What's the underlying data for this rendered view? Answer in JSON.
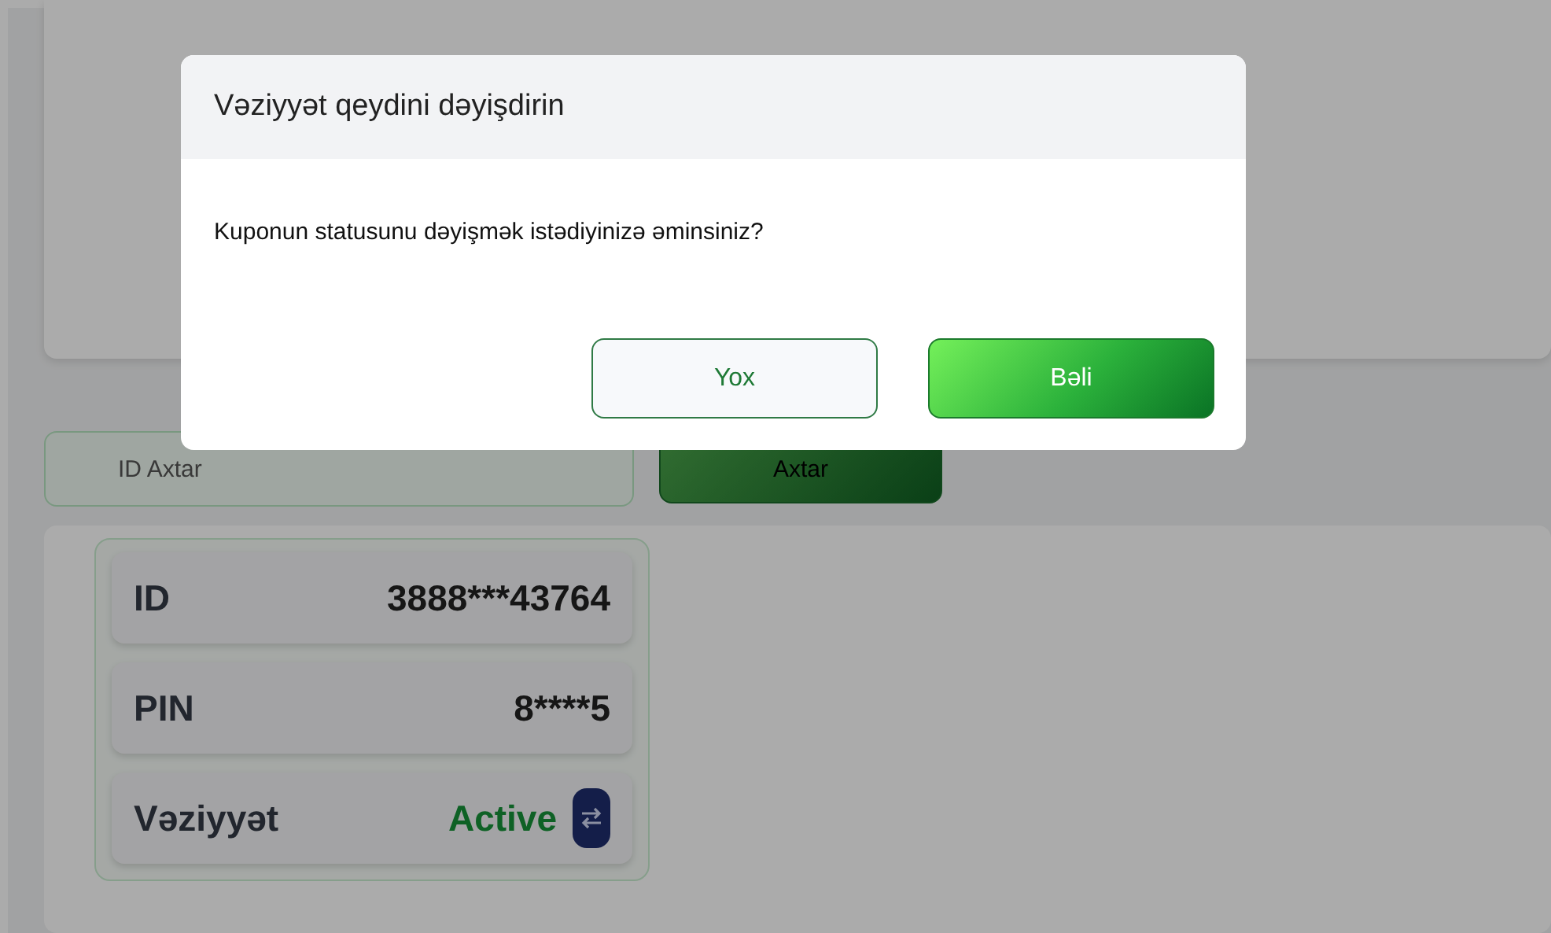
{
  "search": {
    "placeholder": "ID Axtar",
    "button": "Axtar"
  },
  "coupon": {
    "rows": [
      {
        "kind": "plain",
        "label": "ID",
        "value": "3888***43764"
      },
      {
        "kind": "plain",
        "label": "PIN",
        "value": "8****5"
      },
      {
        "kind": "status",
        "label": "Vəziyyət",
        "value": "Active"
      }
    ]
  },
  "dialog": {
    "title": "Vəziyyət qeydini dəyişdirin",
    "message": "Kuponun statusunu dəyişmək istədiyinizə əminsiniz?",
    "buttons": [
      {
        "kind": "secondary",
        "label": "Yox"
      },
      {
        "kind": "primary",
        "label": "Bəli"
      }
    ]
  }
}
